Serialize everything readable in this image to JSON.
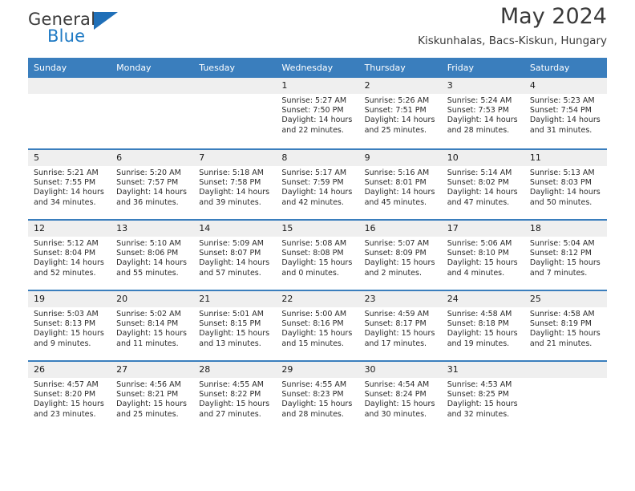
{
  "brand": {
    "name_part1": "General",
    "name_part2": "Blue",
    "triangle_color": "#1f6fb8",
    "blue_text_color": "#1f7ac4"
  },
  "header": {
    "month_title": "May 2024",
    "location": "Kiskunhalas, Bacs-Kiskun, Hungary",
    "header_bg": "#3a7ebd",
    "daynumber_bg": "#efefef"
  },
  "weekdays": [
    {
      "label": "Sunday"
    },
    {
      "label": "Monday"
    },
    {
      "label": "Tuesday"
    },
    {
      "label": "Wednesday"
    },
    {
      "label": "Thursday"
    },
    {
      "label": "Friday"
    },
    {
      "label": "Saturday"
    }
  ],
  "weeks": [
    [
      {
        "day": "",
        "empty": true,
        "sunrise": "",
        "sunset": "",
        "daylight_line1": "",
        "daylight_line2": ""
      },
      {
        "day": "",
        "empty": true,
        "sunrise": "",
        "sunset": "",
        "daylight_line1": "",
        "daylight_line2": ""
      },
      {
        "day": "",
        "empty": true,
        "sunrise": "",
        "sunset": "",
        "daylight_line1": "",
        "daylight_line2": ""
      },
      {
        "day": "1",
        "empty": false,
        "sunrise": "Sunrise: 5:27 AM",
        "sunset": "Sunset: 7:50 PM",
        "daylight_line1": "Daylight: 14 hours",
        "daylight_line2": "and 22 minutes."
      },
      {
        "day": "2",
        "empty": false,
        "sunrise": "Sunrise: 5:26 AM",
        "sunset": "Sunset: 7:51 PM",
        "daylight_line1": "Daylight: 14 hours",
        "daylight_line2": "and 25 minutes."
      },
      {
        "day": "3",
        "empty": false,
        "sunrise": "Sunrise: 5:24 AM",
        "sunset": "Sunset: 7:53 PM",
        "daylight_line1": "Daylight: 14 hours",
        "daylight_line2": "and 28 minutes."
      },
      {
        "day": "4",
        "empty": false,
        "sunrise": "Sunrise: 5:23 AM",
        "sunset": "Sunset: 7:54 PM",
        "daylight_line1": "Daylight: 14 hours",
        "daylight_line2": "and 31 minutes."
      }
    ],
    [
      {
        "day": "5",
        "empty": false,
        "sunrise": "Sunrise: 5:21 AM",
        "sunset": "Sunset: 7:55 PM",
        "daylight_line1": "Daylight: 14 hours",
        "daylight_line2": "and 34 minutes."
      },
      {
        "day": "6",
        "empty": false,
        "sunrise": "Sunrise: 5:20 AM",
        "sunset": "Sunset: 7:57 PM",
        "daylight_line1": "Daylight: 14 hours",
        "daylight_line2": "and 36 minutes."
      },
      {
        "day": "7",
        "empty": false,
        "sunrise": "Sunrise: 5:18 AM",
        "sunset": "Sunset: 7:58 PM",
        "daylight_line1": "Daylight: 14 hours",
        "daylight_line2": "and 39 minutes."
      },
      {
        "day": "8",
        "empty": false,
        "sunrise": "Sunrise: 5:17 AM",
        "sunset": "Sunset: 7:59 PM",
        "daylight_line1": "Daylight: 14 hours",
        "daylight_line2": "and 42 minutes."
      },
      {
        "day": "9",
        "empty": false,
        "sunrise": "Sunrise: 5:16 AM",
        "sunset": "Sunset: 8:01 PM",
        "daylight_line1": "Daylight: 14 hours",
        "daylight_line2": "and 45 minutes."
      },
      {
        "day": "10",
        "empty": false,
        "sunrise": "Sunrise: 5:14 AM",
        "sunset": "Sunset: 8:02 PM",
        "daylight_line1": "Daylight: 14 hours",
        "daylight_line2": "and 47 minutes."
      },
      {
        "day": "11",
        "empty": false,
        "sunrise": "Sunrise: 5:13 AM",
        "sunset": "Sunset: 8:03 PM",
        "daylight_line1": "Daylight: 14 hours",
        "daylight_line2": "and 50 minutes."
      }
    ],
    [
      {
        "day": "12",
        "empty": false,
        "sunrise": "Sunrise: 5:12 AM",
        "sunset": "Sunset: 8:04 PM",
        "daylight_line1": "Daylight: 14 hours",
        "daylight_line2": "and 52 minutes."
      },
      {
        "day": "13",
        "empty": false,
        "sunrise": "Sunrise: 5:10 AM",
        "sunset": "Sunset: 8:06 PM",
        "daylight_line1": "Daylight: 14 hours",
        "daylight_line2": "and 55 minutes."
      },
      {
        "day": "14",
        "empty": false,
        "sunrise": "Sunrise: 5:09 AM",
        "sunset": "Sunset: 8:07 PM",
        "daylight_line1": "Daylight: 14 hours",
        "daylight_line2": "and 57 minutes."
      },
      {
        "day": "15",
        "empty": false,
        "sunrise": "Sunrise: 5:08 AM",
        "sunset": "Sunset: 8:08 PM",
        "daylight_line1": "Daylight: 15 hours",
        "daylight_line2": "and 0 minutes."
      },
      {
        "day": "16",
        "empty": false,
        "sunrise": "Sunrise: 5:07 AM",
        "sunset": "Sunset: 8:09 PM",
        "daylight_line1": "Daylight: 15 hours",
        "daylight_line2": "and 2 minutes."
      },
      {
        "day": "17",
        "empty": false,
        "sunrise": "Sunrise: 5:06 AM",
        "sunset": "Sunset: 8:10 PM",
        "daylight_line1": "Daylight: 15 hours",
        "daylight_line2": "and 4 minutes."
      },
      {
        "day": "18",
        "empty": false,
        "sunrise": "Sunrise: 5:04 AM",
        "sunset": "Sunset: 8:12 PM",
        "daylight_line1": "Daylight: 15 hours",
        "daylight_line2": "and 7 minutes."
      }
    ],
    [
      {
        "day": "19",
        "empty": false,
        "sunrise": "Sunrise: 5:03 AM",
        "sunset": "Sunset: 8:13 PM",
        "daylight_line1": "Daylight: 15 hours",
        "daylight_line2": "and 9 minutes."
      },
      {
        "day": "20",
        "empty": false,
        "sunrise": "Sunrise: 5:02 AM",
        "sunset": "Sunset: 8:14 PM",
        "daylight_line1": "Daylight: 15 hours",
        "daylight_line2": "and 11 minutes."
      },
      {
        "day": "21",
        "empty": false,
        "sunrise": "Sunrise: 5:01 AM",
        "sunset": "Sunset: 8:15 PM",
        "daylight_line1": "Daylight: 15 hours",
        "daylight_line2": "and 13 minutes."
      },
      {
        "day": "22",
        "empty": false,
        "sunrise": "Sunrise: 5:00 AM",
        "sunset": "Sunset: 8:16 PM",
        "daylight_line1": "Daylight: 15 hours",
        "daylight_line2": "and 15 minutes."
      },
      {
        "day": "23",
        "empty": false,
        "sunrise": "Sunrise: 4:59 AM",
        "sunset": "Sunset: 8:17 PM",
        "daylight_line1": "Daylight: 15 hours",
        "daylight_line2": "and 17 minutes."
      },
      {
        "day": "24",
        "empty": false,
        "sunrise": "Sunrise: 4:58 AM",
        "sunset": "Sunset: 8:18 PM",
        "daylight_line1": "Daylight: 15 hours",
        "daylight_line2": "and 19 minutes."
      },
      {
        "day": "25",
        "empty": false,
        "sunrise": "Sunrise: 4:58 AM",
        "sunset": "Sunset: 8:19 PM",
        "daylight_line1": "Daylight: 15 hours",
        "daylight_line2": "and 21 minutes."
      }
    ],
    [
      {
        "day": "26",
        "empty": false,
        "sunrise": "Sunrise: 4:57 AM",
        "sunset": "Sunset: 8:20 PM",
        "daylight_line1": "Daylight: 15 hours",
        "daylight_line2": "and 23 minutes."
      },
      {
        "day": "27",
        "empty": false,
        "sunrise": "Sunrise: 4:56 AM",
        "sunset": "Sunset: 8:21 PM",
        "daylight_line1": "Daylight: 15 hours",
        "daylight_line2": "and 25 minutes."
      },
      {
        "day": "28",
        "empty": false,
        "sunrise": "Sunrise: 4:55 AM",
        "sunset": "Sunset: 8:22 PM",
        "daylight_line1": "Daylight: 15 hours",
        "daylight_line2": "and 27 minutes."
      },
      {
        "day": "29",
        "empty": false,
        "sunrise": "Sunrise: 4:55 AM",
        "sunset": "Sunset: 8:23 PM",
        "daylight_line1": "Daylight: 15 hours",
        "daylight_line2": "and 28 minutes."
      },
      {
        "day": "30",
        "empty": false,
        "sunrise": "Sunrise: 4:54 AM",
        "sunset": "Sunset: 8:24 PM",
        "daylight_line1": "Daylight: 15 hours",
        "daylight_line2": "and 30 minutes."
      },
      {
        "day": "31",
        "empty": false,
        "sunrise": "Sunrise: 4:53 AM",
        "sunset": "Sunset: 8:25 PM",
        "daylight_line1": "Daylight: 15 hours",
        "daylight_line2": "and 32 minutes."
      },
      {
        "day": "",
        "empty": true,
        "sunrise": "",
        "sunset": "",
        "daylight_line1": "",
        "daylight_line2": ""
      }
    ]
  ]
}
